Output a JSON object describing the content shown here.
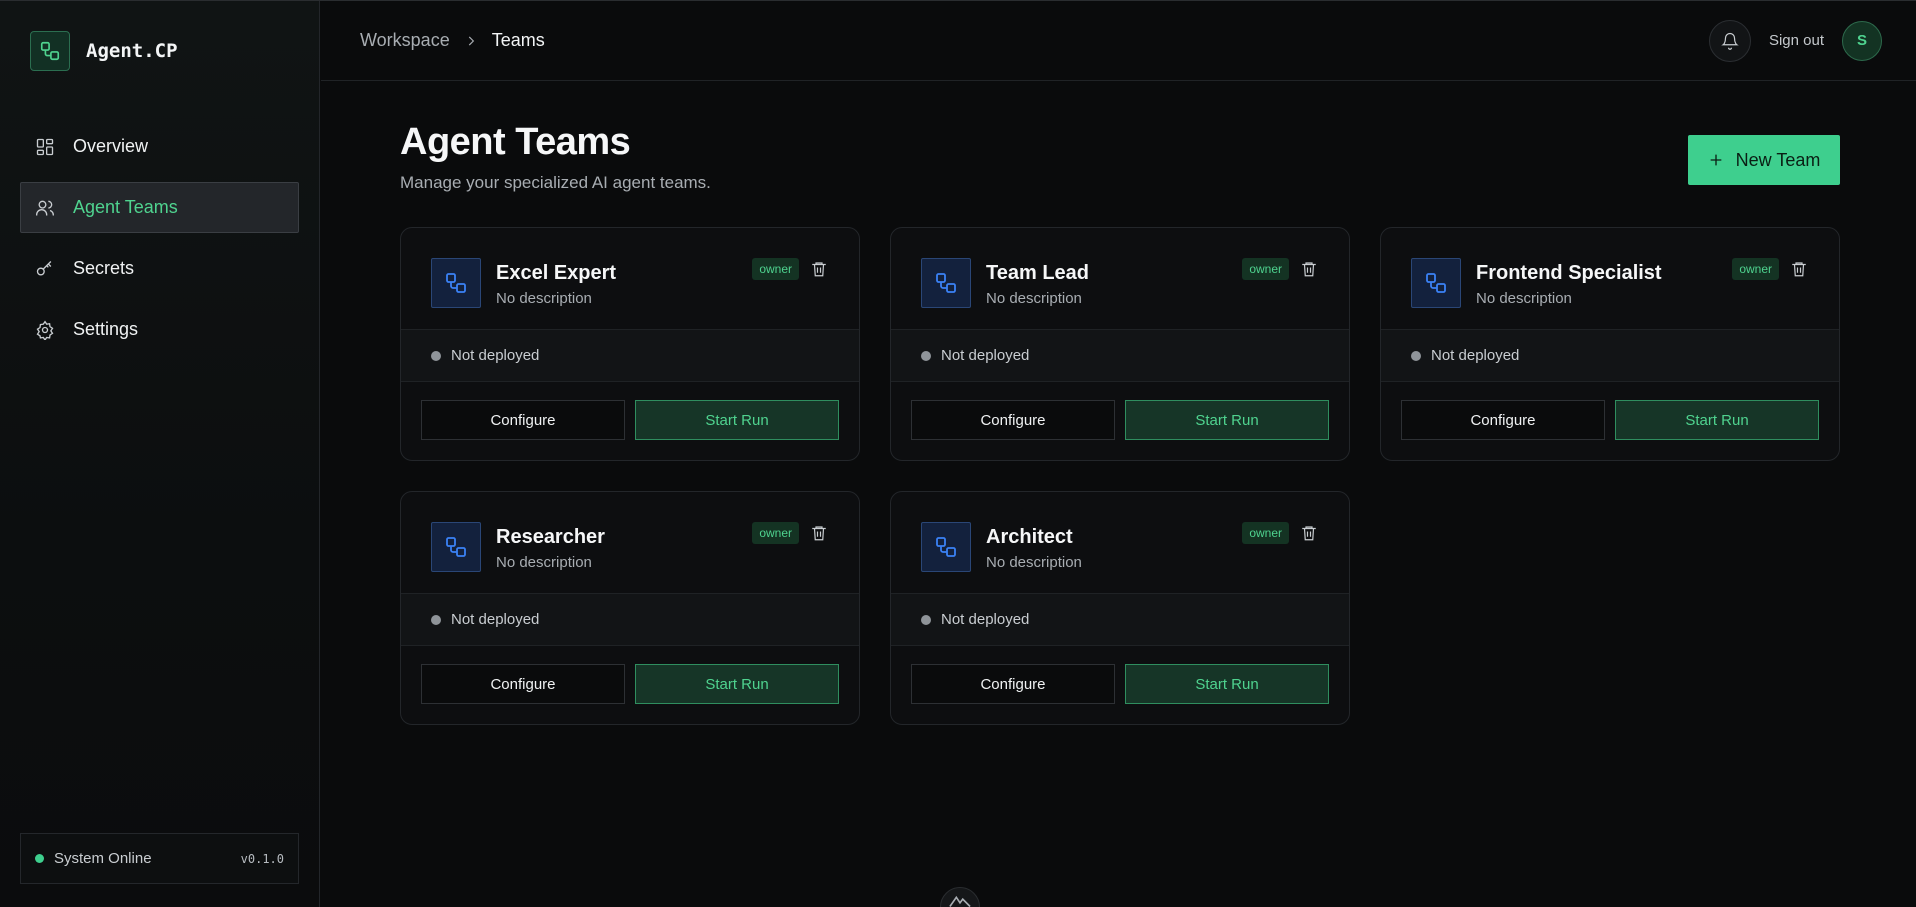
{
  "app": {
    "name": "Agent.CP",
    "logo_icon": "workflow-icon"
  },
  "sidebar": {
    "items": [
      {
        "label": "Overview",
        "icon": "grid-icon",
        "active": false
      },
      {
        "label": "Agent Teams",
        "icon": "users-icon",
        "active": true
      },
      {
        "label": "Secrets",
        "icon": "key-icon",
        "active": false
      },
      {
        "label": "Settings",
        "icon": "gear-icon",
        "active": false
      }
    ],
    "status": {
      "label": "System Online",
      "version": "v0.1.0"
    }
  },
  "header": {
    "breadcrumb": [
      "Workspace",
      "Teams"
    ],
    "signout_label": "Sign out",
    "avatar_initial": "S"
  },
  "main": {
    "title": "Agent Teams",
    "subtitle": "Manage your specialized AI agent teams.",
    "new_team_label": "New Team",
    "teams": [
      {
        "name": "Excel Expert",
        "description": "No description",
        "role": "owner",
        "status": "Not deployed",
        "configure_label": "Configure",
        "run_label": "Start Run"
      },
      {
        "name": "Team Lead",
        "description": "No description",
        "role": "owner",
        "status": "Not deployed",
        "configure_label": "Configure",
        "run_label": "Start Run"
      },
      {
        "name": "Frontend Specialist",
        "description": "No description",
        "role": "owner",
        "status": "Not deployed",
        "configure_label": "Configure",
        "run_label": "Start Run"
      },
      {
        "name": "Researcher",
        "description": "No description",
        "role": "owner",
        "status": "Not deployed",
        "configure_label": "Configure",
        "run_label": "Start Run"
      },
      {
        "name": "Architect",
        "description": "No description",
        "role": "owner",
        "status": "Not deployed",
        "configure_label": "Configure",
        "run_label": "Start Run"
      }
    ]
  },
  "colors": {
    "accent": "#3ecf8e",
    "background": "#0a0b0c",
    "icon_blue": "#3b82f6"
  }
}
